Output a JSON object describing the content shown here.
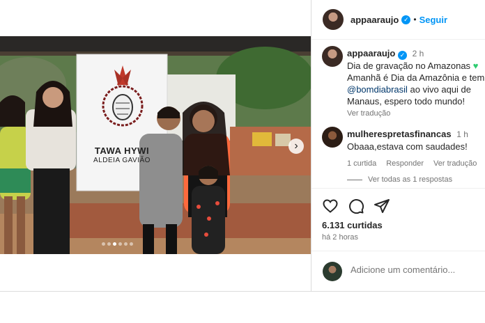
{
  "post": {
    "username": "appaaraujo",
    "follow_label": "Seguir",
    "time_ago": "2 h",
    "caption_lines": [
      "Dia de gravação no Amazonas",
      "Amanhã é Dia da Amazônia e tem",
      "@bomdiabrasil ao vivo aqui de",
      "Manaus, espero todo mundo!"
    ],
    "mention": "@bomdiabrasil",
    "see_translation": "Ver tradução",
    "banner": {
      "title": "TAWA HYWI",
      "subtitle": "ALDEIA GAVIÃO"
    }
  },
  "comment": {
    "username": "mulherespretasfinancas",
    "time_ago": "1 h",
    "text": "Obaaa,estava com saudades!",
    "likes_label": "1 curtida",
    "reply_label": "Responder",
    "translate_label": "Ver tradução",
    "replies_label": "Ver todas as 1 respostas"
  },
  "stats": {
    "likes": "6.131 curtidas",
    "posted": "há 2 horas"
  },
  "add_comment": {
    "placeholder": "Adicione um comentário..."
  },
  "colors": {
    "accent": "#0095f6",
    "heart": "#2ecc71"
  },
  "icons": [
    "heart-icon",
    "comment-icon",
    "share-icon",
    "next-arrow-icon",
    "verified-icon"
  ],
  "carousel": {
    "current": 3,
    "total": 6
  }
}
